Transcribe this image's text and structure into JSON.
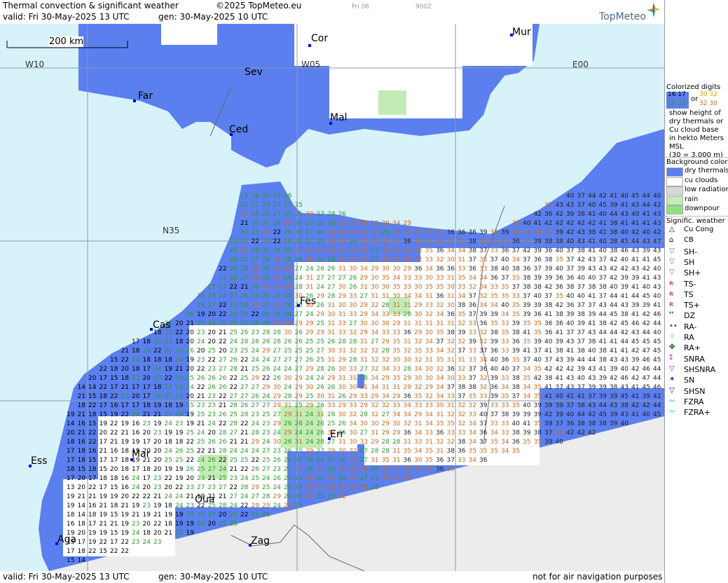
{
  "header": {
    "title": "Thermal convection & significant weather",
    "copyright": "©2025 TopMeteo.eu",
    "valid": "valid:  Fri  30-May-2025  13 UTC",
    "gen": "gen: 30-May-2025 10 UTC",
    "dim1": "Fri 06",
    "dim2": "9002",
    "brand": "TopMeteo"
  },
  "footer": {
    "valid": "valid:  Fri  30-May-2025  13 UTC",
    "gen": "gen: 30-May-2025 10 UTC",
    "note": "not for air navigation purposes"
  },
  "map": {
    "scale_label": "200 km",
    "grid_labels": [
      {
        "id": "w10",
        "text": "W10"
      },
      {
        "id": "w05",
        "text": "W05"
      },
      {
        "id": "e00",
        "text": "E00"
      },
      {
        "id": "n35",
        "text": "N35"
      }
    ],
    "cities": [
      {
        "id": "mur",
        "text": "Mur"
      },
      {
        "id": "cor",
        "text": "Cor"
      },
      {
        "id": "sev",
        "text": "Sev"
      },
      {
        "id": "far",
        "text": "Far"
      },
      {
        "id": "ced",
        "text": "Ced"
      },
      {
        "id": "mal",
        "text": "Mal"
      },
      {
        "id": "fes",
        "text": "Fes"
      },
      {
        "id": "cas",
        "text": "Cas"
      },
      {
        "id": "err",
        "text": "Err"
      },
      {
        "id": "ess",
        "text": "Ess"
      },
      {
        "id": "mar",
        "text": "Mar"
      },
      {
        "id": "oua",
        "text": "Oua"
      },
      {
        "id": "aga",
        "text": "Aga"
      },
      {
        "id": "zag",
        "text": "Zag"
      }
    ],
    "colors": {
      "sea": "#d8f2fa",
      "dry_thermals": "#5b7fee",
      "cu_clouds": "#ffffff",
      "low_radiation": "#d8d8d8",
      "rain": "#c3ecb4",
      "downpour": "#90e07a",
      "no_data": "#ececec"
    }
  },
  "legend": {
    "colorized_title": "Colorized digits",
    "sample_a1": "16 17",
    "sample_a2": "28 25",
    "or": "or",
    "sample_b1": "30 32",
    "sample_b2": "32 30",
    "desc": [
      "show height of",
      "dry thermals or",
      "Cu cloud base",
      "in hekto Meters",
      "MSL",
      "(30 = 3.000 m)"
    ],
    "bg_title": "Background color",
    "bg_items": [
      {
        "label": "dry thermals",
        "color": "#5b7fee"
      },
      {
        "label": "cu clouds",
        "color": "#ffffff"
      },
      {
        "label": "low radiation",
        "color": "#d8d8d8"
      },
      {
        "label": "rain",
        "color": "#c3ecb4"
      },
      {
        "label": "downpour",
        "color": "#90e07a"
      }
    ],
    "sig_title": "Signific. weather",
    "sig_items": [
      {
        "label": "Cu Cong",
        "icon": "cu-cong-icon"
      },
      {
        "label": "CB",
        "icon": "cb-icon"
      },
      {
        "label": "SH-",
        "icon": "shower-light-icon"
      },
      {
        "label": "SH",
        "icon": "shower-icon"
      },
      {
        "label": "SH+",
        "icon": "shower-heavy-icon"
      },
      {
        "label": "TS-",
        "icon": "thunder-light-icon"
      },
      {
        "label": "TS",
        "icon": "thunder-icon"
      },
      {
        "label": "TS+",
        "icon": "thunder-heavy-icon"
      },
      {
        "label": "DZ",
        "icon": "drizzle-icon"
      },
      {
        "label": "RA-",
        "icon": "rain-light-icon"
      },
      {
        "label": "RA",
        "icon": "rain-icon"
      },
      {
        "label": "RA+",
        "icon": "rain-heavy-icon"
      },
      {
        "label": "SNRA",
        "icon": "sleet-icon"
      },
      {
        "label": "SHSNRA",
        "icon": "sleet-shower-icon"
      },
      {
        "label": "SN",
        "icon": "snow-icon"
      },
      {
        "label": "SHSN",
        "icon": "snow-shower-icon"
      },
      {
        "label": "FZRA",
        "icon": "freezing-rain-icon"
      },
      {
        "label": "FZRA+",
        "icon": "freezing-rain-heavy-icon"
      }
    ]
  }
}
